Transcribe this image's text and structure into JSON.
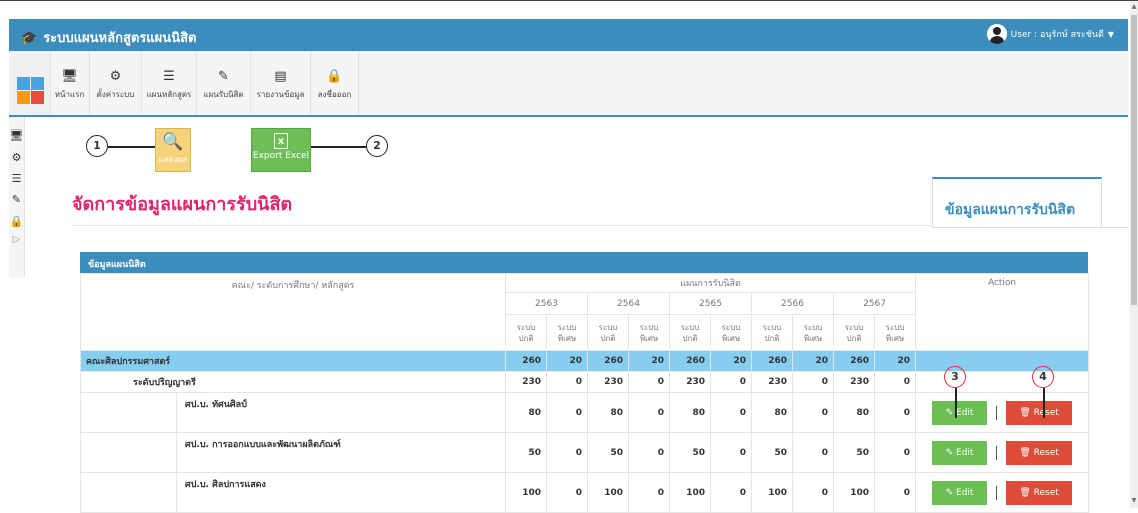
{
  "app": {
    "title": "ระบบแผนหลักสูตรแผนนิสิต",
    "user_label": "User : อนุรักษ์ สระชันดี"
  },
  "toolbar": {
    "items": [
      {
        "label": "หน้าแรก",
        "icon": "monitor-icon"
      },
      {
        "label": "ตั้งค่าระบบ",
        "icon": "gears-icon"
      },
      {
        "label": "แผนหลักสูตร",
        "icon": "list-icon"
      },
      {
        "label": "แผนรับนิสิต",
        "icon": "edit-icon"
      },
      {
        "label": "รายงานข้อมูล",
        "icon": "report-icon"
      },
      {
        "label": "ลงชื่อออก",
        "icon": "lock-icon"
      }
    ]
  },
  "actions": {
    "show_label": "แสดงผล",
    "excel_label": "Export Excel"
  },
  "callouts": [
    "1",
    "2",
    "3",
    "4"
  ],
  "page": {
    "title": "จัดการข้อมูลแผนการรับนิสิต",
    "tab": "ข้อมูลแผนการรับนิสิต"
  },
  "panel": {
    "title": "ข้อมูลแผนนิสิต"
  },
  "table": {
    "col_program": "คณะ/ ระดับการศึกษา/ หลักสูตร",
    "col_plan": "แผนการรับนิสิต",
    "col_action": "Action",
    "years": [
      "2563",
      "2564",
      "2565",
      "2566",
      "2567"
    ],
    "sys_normal": "ระบบ\nปกติ",
    "sys_special": "ระบบ\nพิเศษ",
    "faculty": {
      "name": "คณะศิลปกรรมศาสตร์",
      "values": [
        "260",
        "20",
        "260",
        "20",
        "260",
        "20",
        "260",
        "20",
        "260",
        "20"
      ]
    },
    "degree": {
      "name": "ระดับปริญญาตรี",
      "values": [
        "230",
        "0",
        "230",
        "0",
        "230",
        "0",
        "230",
        "0",
        "230",
        "0"
      ]
    },
    "programs": [
      {
        "name": "ศป.บ. ทัศนศิลป์",
        "values": [
          "80",
          "0",
          "80",
          "0",
          "80",
          "0",
          "80",
          "0",
          "80",
          "0"
        ]
      },
      {
        "name": "ศป.บ. การออกแบบและพัฒนาผลิตภัณฑ์",
        "values": [
          "50",
          "0",
          "50",
          "0",
          "50",
          "0",
          "50",
          "0",
          "50",
          "0"
        ]
      },
      {
        "name": "ศป.บ. ศิลปการแสดง",
        "values": [
          "100",
          "0",
          "100",
          "0",
          "100",
          "0",
          "100",
          "0",
          "100",
          "0"
        ]
      }
    ],
    "edit_label": "Edit",
    "reset_label": "Reset"
  },
  "colors": {
    "primary": "#3c8dbc",
    "title": "#e2246b",
    "faculty_row": "#86cdf0",
    "edit": "#6cbf55",
    "reset": "#dd4b39",
    "show_btn": "#f5d37a"
  }
}
